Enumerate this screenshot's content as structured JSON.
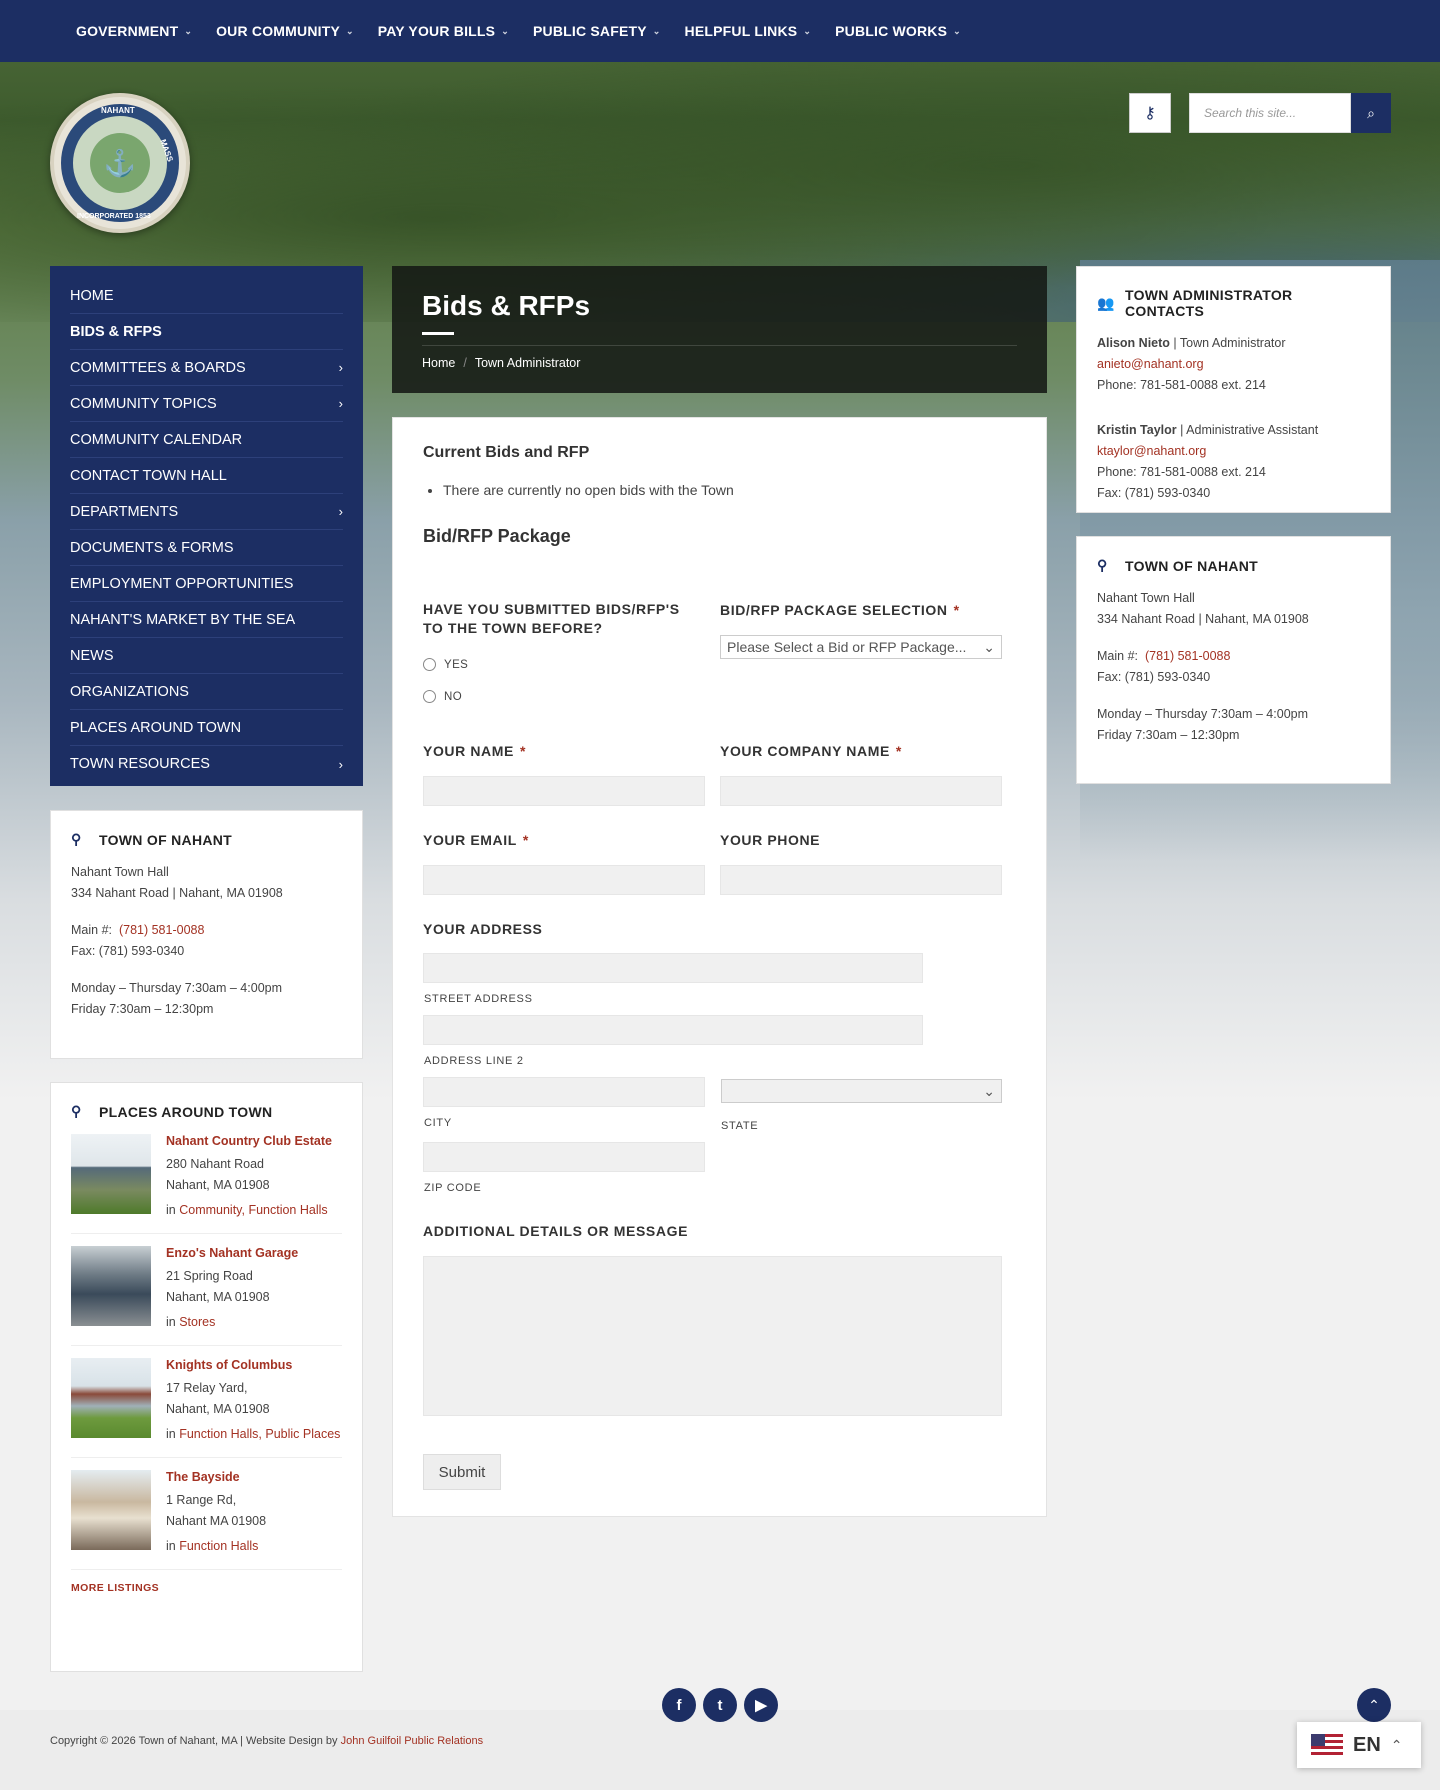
{
  "topnav": {
    "items": [
      "GOVERNMENT",
      "OUR COMMUNITY",
      "PAY YOUR BILLS",
      "PUBLIC SAFETY",
      "HELPFUL LINKS",
      "PUBLIC WORKS"
    ]
  },
  "logo": {
    "text_top": "NAHANT",
    "text_right": "MASS",
    "text_bottom": "INCORPORATED 1853"
  },
  "search": {
    "placeholder": "Search this site..."
  },
  "sidebar": {
    "items": [
      {
        "label": "HOME",
        "has_children": false
      },
      {
        "label": "BIDS & RFPS",
        "has_children": false,
        "active": true
      },
      {
        "label": "COMMITTEES & BOARDS",
        "has_children": true
      },
      {
        "label": "COMMUNITY TOPICS",
        "has_children": true
      },
      {
        "label": "COMMUNITY CALENDAR",
        "has_children": false
      },
      {
        "label": "CONTACT TOWN HALL",
        "has_children": false
      },
      {
        "label": "DEPARTMENTS",
        "has_children": true
      },
      {
        "label": "DOCUMENTS & FORMS",
        "has_children": false
      },
      {
        "label": "EMPLOYMENT OPPORTUNITIES",
        "has_children": false
      },
      {
        "label": "NAHANT'S MARKET BY THE SEA",
        "has_children": false
      },
      {
        "label": "NEWS",
        "has_children": false
      },
      {
        "label": "ORGANIZATIONS",
        "has_children": false
      },
      {
        "label": "PLACES AROUND TOWN",
        "has_children": false
      },
      {
        "label": "TOWN RESOURCES",
        "has_children": true
      }
    ]
  },
  "town_card": {
    "title": "TOWN OF NAHANT",
    "hall": "Nahant Town Hall",
    "address": "334 Nahant Road | Nahant, MA 01908",
    "main_label": "Main #:",
    "main_phone": "(781) 581-0088",
    "fax": "Fax: (781) 593-0340",
    "hours1": "Monday – Thursday 7:30am – 4:00pm",
    "hours2": "Friday 7:30am – 12:30pm"
  },
  "places": {
    "title": "PLACES AROUND TOWN",
    "items": [
      {
        "name": "Nahant Country Club Estate",
        "line1": "280 Nahant Road",
        "line2": "Nahant, MA 01908",
        "in": "in",
        "cats": "Community, Function Halls"
      },
      {
        "name": "Enzo's Nahant Garage",
        "line1": "21 Spring Road",
        "line2": "Nahant, MA 01908",
        "in": "in",
        "cats": "Stores"
      },
      {
        "name": "Knights of Columbus",
        "line1": "17 Relay Yard,",
        "line2": "Nahant, MA 01908",
        "in": "in",
        "cats": "Function Halls, Public Places"
      },
      {
        "name": "The Bayside",
        "line1": "1 Range Rd,",
        "line2": "Nahant MA 01908",
        "in": "in",
        "cats": "Function Halls"
      }
    ],
    "more": "MORE LISTINGS"
  },
  "header": {
    "title": "Bids & RFPs",
    "breadcrumb": [
      "Home",
      "Town Administrator"
    ]
  },
  "main": {
    "section1": "Current Bids and RFP",
    "bullet": "There are currently no open bids with the Town",
    "section2": "Bid/RFP Package",
    "q_submitted": "HAVE YOU SUBMITTED BIDS/RFP'S TO THE TOWN BEFORE?",
    "opt_yes": "YES",
    "opt_no": "NO",
    "package_label": "BID/RFP PACKAGE SELECTION",
    "package_value": "Please Select a Bid or RFP Package...",
    "name_label": "YOUR NAME",
    "company_label": "YOUR COMPANY NAME",
    "email_label": "YOUR EMAIL",
    "phone_label": "YOUR PHONE",
    "address_label": "YOUR ADDRESS",
    "street": "STREET ADDRESS",
    "line2": "ADDRESS LINE 2",
    "city": "CITY",
    "state": "STATE",
    "zip": "ZIP CODE",
    "message_label": "ADDITIONAL DETAILS OR MESSAGE",
    "submit": "Submit",
    "req_mark": "*"
  },
  "contacts": {
    "title": "TOWN ADMINISTRATOR CONTACTS",
    "people": [
      {
        "name": "Alison Nieto",
        "role": "| Town Administrator",
        "email": "anieto@nahant.org",
        "phone": "Phone: 781-581-0088 ext. 214"
      },
      {
        "name": "Kristin Taylor",
        "role": "| Administrative Assistant",
        "email": "ktaylor@nahant.org",
        "phone": "Phone: 781-581-0088 ext. 214",
        "fax": "Fax: (781) 593-0340"
      }
    ]
  },
  "footer": {
    "copyright": "Copyright © 2026 Town of Nahant, MA | Website Design by",
    "designer": "John Guilfoil Public Relations",
    "social": [
      "f",
      "t",
      "▶"
    ]
  },
  "lang": {
    "code": "EN"
  },
  "colors": {
    "navy": "#1c2e63",
    "link": "#a33223"
  }
}
